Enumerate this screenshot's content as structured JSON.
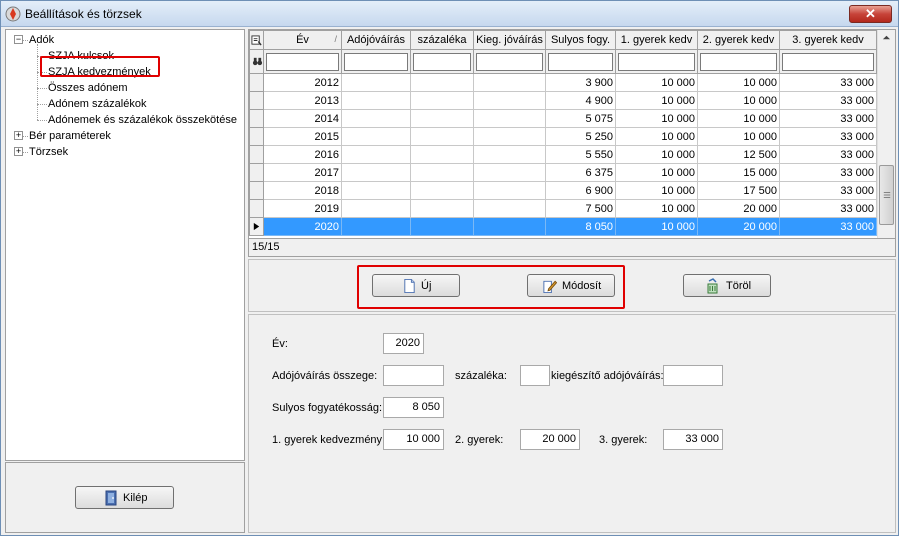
{
  "window": {
    "title": "Beállítások és törzsek",
    "close_label": "✕"
  },
  "tree": {
    "items": [
      {
        "label": "Adók",
        "level": 0,
        "expander": "−"
      },
      {
        "label": "SZJA kulcsok",
        "level": 1
      },
      {
        "label": "SZJA kedvezmények",
        "level": 1
      },
      {
        "label": "Összes adónem",
        "level": 1
      },
      {
        "label": "Adónem százalékok",
        "level": 1
      },
      {
        "label": "Adónemek és százalékok összekötése",
        "level": 1
      },
      {
        "label": "Bér paraméterek",
        "level": 0,
        "expander": "+"
      },
      {
        "label": "Törzsek",
        "level": 0,
        "expander": "+"
      }
    ]
  },
  "exit_button": {
    "label": "Kilép"
  },
  "grid": {
    "columns": [
      "Év",
      "Adójóváírás",
      "százaléka",
      "Kieg. jóváírás",
      "Sulyos fogy.",
      "1. gyerek kedv",
      "2. gyerek kedv",
      "3. gyerek kedv"
    ],
    "sort_indicator": "/",
    "rows": [
      [
        "2012",
        "",
        "",
        "",
        "3 900",
        "10 000",
        "10 000",
        "33 000"
      ],
      [
        "2013",
        "",
        "",
        "",
        "4 900",
        "10 000",
        "10 000",
        "33 000"
      ],
      [
        "2014",
        "",
        "",
        "",
        "5 075",
        "10 000",
        "10 000",
        "33 000"
      ],
      [
        "2015",
        "",
        "",
        "",
        "5 250",
        "10 000",
        "10 000",
        "33 000"
      ],
      [
        "2016",
        "",
        "",
        "",
        "5 550",
        "10 000",
        "12 500",
        "33 000"
      ],
      [
        "2017",
        "",
        "",
        "",
        "6 375",
        "10 000",
        "15 000",
        "33 000"
      ],
      [
        "2018",
        "",
        "",
        "",
        "6 900",
        "10 000",
        "17 500",
        "33 000"
      ],
      [
        "2019",
        "",
        "",
        "",
        "7 500",
        "10 000",
        "20 000",
        "33 000"
      ],
      [
        "2020",
        "",
        "",
        "",
        "8 050",
        "10 000",
        "20 000",
        "33 000"
      ]
    ],
    "selected_index": 8,
    "record_count": "15/15"
  },
  "actions": {
    "new_label": "Új",
    "modify_label": "Módosít",
    "delete_label": "Töröl"
  },
  "form": {
    "year_label": "Év:",
    "year_value": "2020",
    "credit_label": "Adójóváírás összege:",
    "credit_value": "",
    "percent_label": "százaléka:",
    "percent_value": "",
    "extra_label": "kiegészítő adójóváírás:",
    "extra_value": "",
    "disability_label": "Sulyos fogyatékosság:",
    "disability_value": "8 050",
    "child1_label": "1. gyerek kedvezmény:",
    "child1_value": "10 000",
    "child2_label": "2. gyerek:",
    "child2_value": "20 000",
    "child3_label": "3. gyerek:",
    "child3_value": "33 000"
  },
  "colors": {
    "selection": "#3399ff",
    "highlight": "#e00000"
  }
}
